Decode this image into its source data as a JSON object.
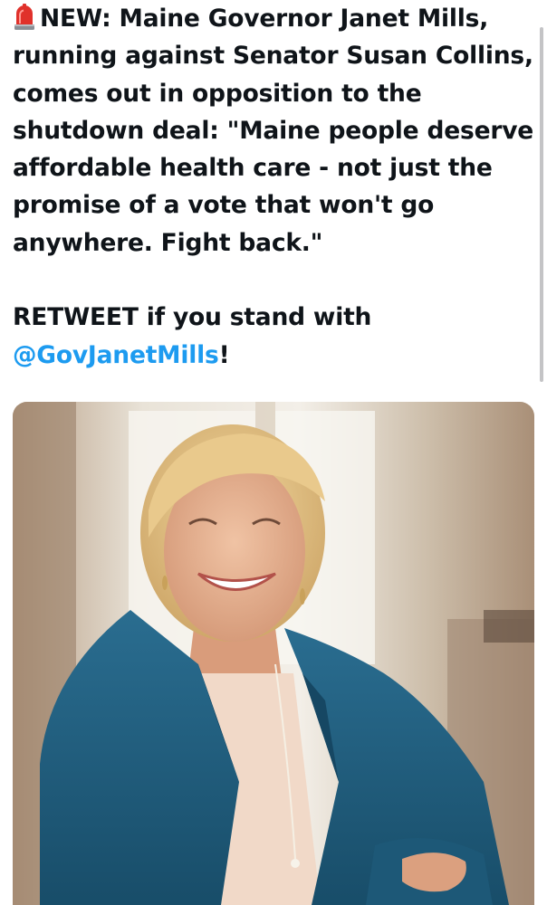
{
  "tweet": {
    "lines": [
      "NEW: Maine Governor Janet Mills,",
      "running against Senator Susan Collins,",
      "comes out in opposition to the",
      "shutdown deal: \"Maine people deserve",
      "affordable health care - not just the",
      "promise of a vote that won't go",
      "anywhere. Fight back.\""
    ],
    "cta_prefix": "RETWEET if you stand with",
    "mention": "@GovJanetMills",
    "cta_suffix": "!",
    "leading_icon": "police-siren-icon"
  },
  "media": {
    "type": "photo",
    "subject": "portrait-photo"
  },
  "colors": {
    "mention": "#1d9bf0",
    "text": "#0f1419",
    "background": "#ffffff",
    "jacket": "#1f5f80"
  }
}
